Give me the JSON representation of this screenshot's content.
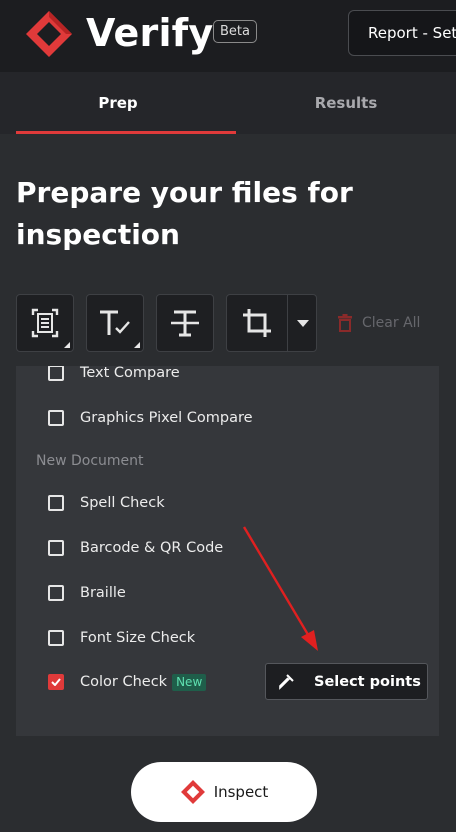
{
  "app": {
    "title": "Verify",
    "badge": "Beta",
    "report_button": "Report - Set C"
  },
  "tabs": [
    {
      "label": "Prep",
      "active": true
    },
    {
      "label": "Results",
      "active": false
    }
  ],
  "heading": "Prepare your files for inspection",
  "toolbar": {
    "tools": [
      {
        "icon": "document-scan-icon"
      },
      {
        "icon": "text-check-icon"
      },
      {
        "icon": "text-strikethrough-icon"
      },
      {
        "icon": "crop-icon"
      }
    ],
    "clear_all": "Clear All"
  },
  "options": {
    "text_compare": {
      "label": "Text Compare",
      "checked": false
    },
    "graphics_pixel_compare": {
      "label": "Graphics Pixel Compare",
      "checked": false
    },
    "section_new_document": "New Document",
    "spell_check": {
      "label": "Spell Check",
      "checked": false
    },
    "barcode_qr": {
      "label": "Barcode & QR Code",
      "checked": false
    },
    "braille": {
      "label": "Braille",
      "checked": false
    },
    "font_size_check": {
      "label": "Font Size Check",
      "checked": false
    },
    "color_check": {
      "label": "Color Check",
      "checked": true,
      "badge": "New"
    }
  },
  "select_points": "Select points",
  "inspect": "Inspect",
  "colors": {
    "accent": "#e03a3a",
    "background": "#2b2d30",
    "panel": "#35373b",
    "annotation_arrow": "#e02020"
  }
}
